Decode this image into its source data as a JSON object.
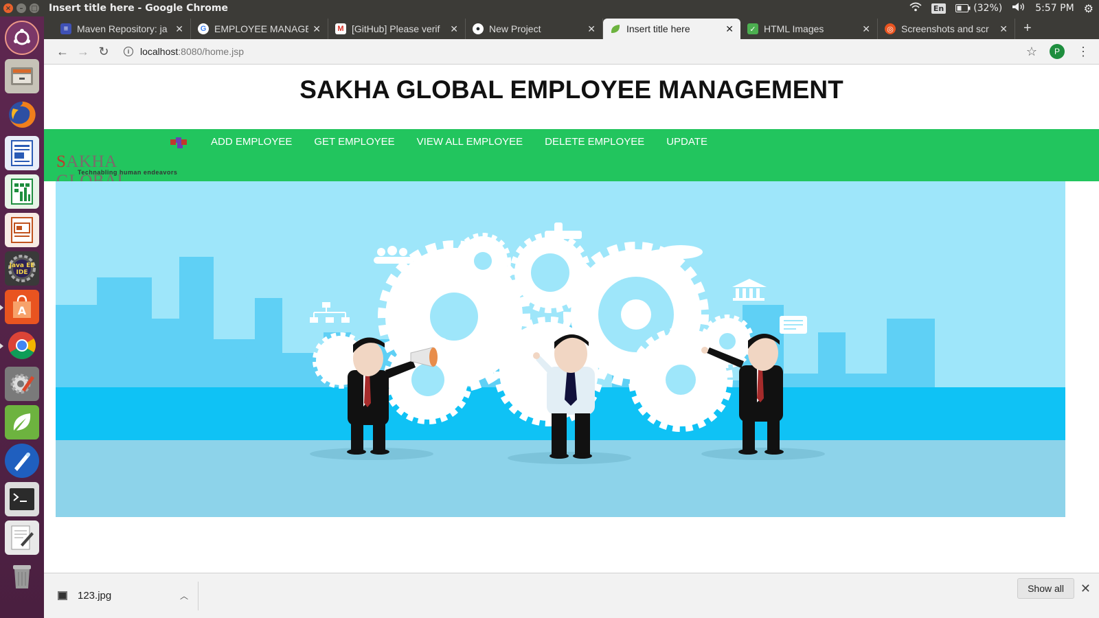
{
  "os": {
    "window_title": "Insert title here - Google Chrome",
    "tray": {
      "language": "En",
      "battery": "(32%)",
      "time": "5:57 PM"
    },
    "launcher": [
      {
        "name": "ubuntu-dash-icon"
      },
      {
        "name": "files-icon"
      },
      {
        "name": "firefox-icon"
      },
      {
        "name": "writer-icon"
      },
      {
        "name": "calc-icon"
      },
      {
        "name": "impress-icon"
      },
      {
        "name": "java-ee-ide-icon",
        "label": "Java EE IDE"
      },
      {
        "name": "software-center-icon"
      },
      {
        "name": "chrome-icon"
      },
      {
        "name": "system-settings-icon"
      },
      {
        "name": "spring-tool-suite-icon"
      },
      {
        "name": "pen-tool-icon"
      },
      {
        "name": "terminal-icon"
      },
      {
        "name": "text-editor-icon"
      },
      {
        "name": "trash-icon"
      }
    ]
  },
  "browser": {
    "tabs": [
      {
        "label": "Maven Repository: ja",
        "favicon_color": "#3f51b5"
      },
      {
        "label": "EMPLOYEE MANAGE",
        "favicon_color": "#4285f4"
      },
      {
        "label": "[GitHub] Please verif",
        "favicon_color": "#d93025"
      },
      {
        "label": "New Project",
        "favicon_color": "#24292e"
      },
      {
        "label": "Insert title here",
        "favicon_color": "#6db33f",
        "active": true
      },
      {
        "label": "HTML Images",
        "favicon_color": "#4caf50"
      },
      {
        "label": "Screenshots and scr",
        "favicon_color": "#e95420"
      }
    ],
    "url_host": "localhost",
    "url_path": ":8080/home.jsp",
    "profile_initial": "P"
  },
  "page": {
    "title": "SAKHA GLOBAL EMPLOYEE MANAGEMENT",
    "logo": {
      "text_first": "S",
      "text_rest": "AKHA GLOBAL",
      "tagline": "Technabling human endeavors"
    },
    "nav": [
      "ADD EMPLOYEE",
      "GET EMPLOYEE",
      "VIEW ALL EMPLOYEE",
      "DELETE EMPLOYEE",
      "UPDATE"
    ],
    "colors": {
      "navbar": "#22c55e",
      "hero_sky": "#9ee6fa",
      "hero_city": "#5fd0f5",
      "hero_ground": "#8dd3ea"
    }
  },
  "downloads": {
    "file": "123.jpg",
    "show_all": "Show all"
  }
}
